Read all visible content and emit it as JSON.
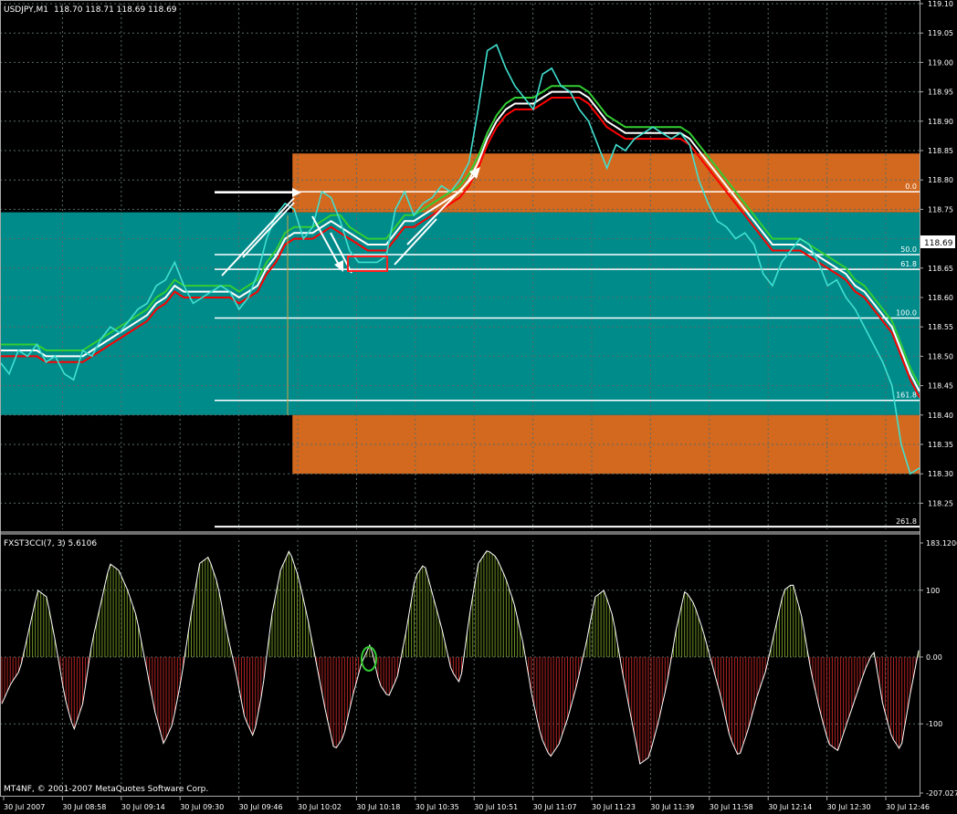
{
  "window": {
    "symbol_label": "USDJPY,M1",
    "ohlc_label": "118.70 118.71 118.69 118.69",
    "current_price": "118.69",
    "indicator_label": "FXST3CCI(7, 3) 5.6106",
    "copyright": "MT4NF, © 2001-2007 MetaQuotes Software Corp."
  },
  "colors": {
    "background": "#000000",
    "grid": "#5a6a6a",
    "cyan_zone": "#008b8b",
    "orange_zone": "#d2691e",
    "price_line": "#40e0d0",
    "ma_green": "#32cd32",
    "ma_white": "#ffffff",
    "ma_red": "#ff0000",
    "cci_positive": "#6b8e23",
    "cci_negative": "#b22222",
    "cci_line": "#ffffff",
    "marker_red": "#ff2020",
    "marker_green": "#32cd32"
  },
  "chart_data": [
    {
      "type": "line",
      "name": "price-panel",
      "y_ticks": [
        "119.10",
        "119.05",
        "119.00",
        "118.95",
        "118.90",
        "118.85",
        "118.80",
        "118.75",
        "118.70",
        "118.65",
        "118.60",
        "118.55",
        "118.50",
        "118.45",
        "118.40",
        "118.35",
        "118.30",
        "118.25"
      ],
      "ylim": [
        118.205,
        119.105
      ],
      "x": [
        0,
        0.01,
        0.02,
        0.03,
        0.04,
        0.05,
        0.06,
        0.07,
        0.08,
        0.09,
        0.1,
        0.11,
        0.12,
        0.13,
        0.14,
        0.15,
        0.16,
        0.17,
        0.18,
        0.19,
        0.2,
        0.21,
        0.22,
        0.23,
        0.24,
        0.25,
        0.26,
        0.27,
        0.28,
        0.29,
        0.3,
        0.31,
        0.32,
        0.33,
        0.34,
        0.35,
        0.36,
        0.37,
        0.38,
        0.39,
        0.4,
        0.41,
        0.42,
        0.43,
        0.44,
        0.45,
        0.46,
        0.47,
        0.48,
        0.49,
        0.5,
        0.51,
        0.52,
        0.53,
        0.54,
        0.55,
        0.56,
        0.57,
        0.58,
        0.59,
        0.6,
        0.61,
        0.62,
        0.63,
        0.64,
        0.65,
        0.66,
        0.67,
        0.68,
        0.69,
        0.7,
        0.71,
        0.72,
        0.73,
        0.74,
        0.75,
        0.76,
        0.77,
        0.78,
        0.79,
        0.8,
        0.81,
        0.82,
        0.83,
        0.84,
        0.85,
        0.86,
        0.87,
        0.88,
        0.89,
        0.9,
        0.91,
        0.92,
        0.93,
        0.94,
        0.95,
        0.96,
        0.97,
        0.98,
        0.99,
        1.0
      ],
      "series": [
        {
          "values": [
            118.49,
            118.47,
            118.51,
            118.5,
            118.52,
            118.49,
            118.5,
            118.47,
            118.46,
            118.51,
            118.5,
            118.53,
            118.55,
            118.54,
            118.56,
            118.58,
            118.59,
            118.62,
            118.63,
            118.66,
            118.62,
            118.59,
            118.6,
            118.61,
            118.62,
            118.61,
            118.58,
            118.6,
            118.64,
            118.7,
            118.74,
            118.76,
            118.75,
            118.7,
            118.72,
            118.78,
            118.77,
            118.73,
            118.68,
            118.66,
            118.66,
            118.66,
            118.67,
            118.75,
            118.78,
            118.74,
            118.76,
            118.77,
            118.79,
            118.78,
            118.8,
            118.83,
            118.92,
            119.02,
            119.03,
            118.99,
            118.96,
            118.94,
            118.92,
            118.98,
            118.99,
            118.96,
            118.95,
            118.92,
            118.9,
            118.86,
            118.82,
            118.86,
            118.85,
            118.87,
            118.88,
            118.89,
            118.88,
            118.87,
            118.88,
            118.86,
            118.8,
            118.76,
            118.73,
            118.72,
            118.7,
            118.71,
            118.69,
            118.64,
            118.62,
            118.66,
            118.68,
            118.7,
            118.69,
            118.66,
            118.62,
            118.63,
            118.6,
            118.58,
            118.55,
            118.52,
            118.49,
            118.45,
            118.35,
            118.3,
            118.31
          ]
        },
        {
          "values": [
            118.52,
            118.52,
            118.52,
            118.52,
            118.52,
            118.51,
            118.51,
            118.51,
            118.51,
            118.51,
            118.52,
            118.53,
            118.54,
            118.55,
            118.56,
            118.57,
            118.58,
            118.6,
            118.61,
            118.63,
            118.62,
            118.62,
            118.62,
            118.62,
            118.62,
            118.62,
            118.61,
            118.62,
            118.63,
            118.66,
            118.68,
            118.71,
            118.72,
            118.72,
            118.72,
            118.73,
            118.74,
            118.74,
            118.72,
            118.71,
            118.7,
            118.7,
            118.7,
            118.72,
            118.74,
            118.74,
            118.75,
            118.76,
            118.77,
            118.78,
            118.79,
            118.81,
            118.84,
            118.88,
            118.91,
            118.93,
            118.94,
            118.94,
            118.94,
            118.95,
            118.96,
            118.96,
            118.96,
            118.96,
            118.95,
            118.93,
            118.91,
            118.9,
            118.89,
            118.89,
            118.89,
            118.89,
            118.89,
            118.89,
            118.89,
            118.88,
            118.86,
            118.84,
            118.82,
            118.8,
            118.78,
            118.76,
            118.74,
            118.72,
            118.7,
            118.7,
            118.7,
            118.7,
            118.69,
            118.68,
            118.67,
            118.66,
            118.65,
            118.63,
            118.62,
            118.6,
            118.58,
            118.56,
            118.52,
            118.48,
            118.45
          ]
        },
        {
          "values": [
            118.51,
            118.51,
            118.51,
            118.51,
            118.51,
            118.5,
            118.5,
            118.5,
            118.5,
            118.5,
            118.51,
            118.52,
            118.53,
            118.54,
            118.55,
            118.56,
            118.57,
            118.59,
            118.6,
            118.62,
            118.61,
            118.61,
            118.61,
            118.61,
            118.61,
            118.61,
            118.6,
            118.61,
            118.62,
            118.65,
            118.67,
            118.7,
            118.71,
            118.71,
            118.71,
            118.72,
            118.73,
            118.72,
            118.71,
            118.7,
            118.69,
            118.69,
            118.69,
            118.71,
            118.73,
            118.73,
            118.74,
            118.75,
            118.76,
            118.77,
            118.78,
            118.8,
            118.83,
            118.87,
            118.9,
            118.92,
            118.93,
            118.93,
            118.93,
            118.94,
            118.95,
            118.95,
            118.95,
            118.95,
            118.94,
            118.92,
            118.9,
            118.89,
            118.88,
            118.88,
            118.88,
            118.88,
            118.88,
            118.88,
            118.88,
            118.87,
            118.85,
            118.83,
            118.81,
            118.79,
            118.77,
            118.75,
            118.73,
            118.71,
            118.69,
            118.69,
            118.69,
            118.69,
            118.68,
            118.67,
            118.66,
            118.65,
            118.64,
            118.62,
            118.61,
            118.59,
            118.57,
            118.55,
            118.51,
            118.47,
            118.44
          ]
        },
        {
          "values": [
            118.5,
            118.5,
            118.5,
            118.5,
            118.5,
            118.49,
            118.49,
            118.49,
            118.49,
            118.49,
            118.5,
            118.51,
            118.52,
            118.53,
            118.54,
            118.55,
            118.56,
            118.58,
            118.59,
            118.61,
            118.6,
            118.6,
            118.6,
            118.6,
            118.6,
            118.6,
            118.59,
            118.6,
            118.61,
            118.64,
            118.66,
            118.69,
            118.7,
            118.7,
            118.7,
            118.71,
            118.72,
            118.71,
            118.7,
            118.69,
            118.68,
            118.68,
            118.68,
            118.7,
            118.72,
            118.72,
            118.73,
            118.74,
            118.75,
            118.76,
            118.77,
            118.79,
            118.82,
            118.86,
            118.89,
            118.91,
            118.92,
            118.92,
            118.92,
            118.93,
            118.94,
            118.94,
            118.94,
            118.94,
            118.93,
            118.91,
            118.89,
            118.88,
            118.87,
            118.87,
            118.87,
            118.87,
            118.87,
            118.87,
            118.87,
            118.86,
            118.84,
            118.82,
            118.8,
            118.78,
            118.76,
            118.74,
            118.72,
            118.7,
            118.68,
            118.68,
            118.68,
            118.68,
            118.67,
            118.66,
            118.65,
            118.64,
            118.63,
            118.61,
            118.6,
            118.58,
            118.56,
            118.54,
            118.5,
            118.46,
            118.43
          ]
        }
      ],
      "zones": [
        {
          "color": "cyan_zone",
          "y_top": 118.745,
          "y_bottom": 118.4,
          "x_start": 0,
          "x_end": 1
        },
        {
          "color": "orange_zone",
          "y_top": 118.845,
          "y_bottom": 118.745,
          "x_start": 0.318,
          "x_end": 1
        },
        {
          "color": "orange_zone",
          "y_top": 118.4,
          "y_bottom": 118.3,
          "x_start": 0.318,
          "x_end": 1
        }
      ],
      "fib_levels": [
        {
          "label": "0.0",
          "value": 118.78
        },
        {
          "label": "50.0",
          "value": 118.673
        },
        {
          "label": "61.8",
          "value": 118.648
        },
        {
          "label": "100.0",
          "value": 118.565
        },
        {
          "label": "161.8",
          "value": 118.425
        },
        {
          "label": "261.8",
          "value": 118.21
        }
      ]
    },
    {
      "type": "bar",
      "name": "cci-panel",
      "y_ticks": [
        "183.1200",
        "100",
        "0.00",
        "-100",
        "-207.0273"
      ],
      "ylim": [
        -207.0273,
        183.12
      ],
      "x_labels": [
        "30 Jul 2007",
        "30 Jul 08:58",
        "30 Jul 09:14",
        "30 Jul 09:30",
        "30 Jul 09:46",
        "30 Jul 10:02",
        "30 Jul 10:18",
        "30 Jul 10:35",
        "30 Jul 10:51",
        "30 Jul 11:07",
        "30 Jul 11:23",
        "30 Jul 11:39",
        "30 Jul 11:58",
        "30 Jul 12:14",
        "30 Jul 12:30",
        "30 Jul 12:46"
      ],
      "values": [
        -70,
        -40,
        -20,
        40,
        100,
        90,
        20,
        -60,
        -110,
        -70,
        20,
        80,
        140,
        130,
        100,
        60,
        -10,
        -80,
        -130,
        -100,
        -30,
        60,
        140,
        150,
        110,
        40,
        -20,
        -90,
        -120,
        -50,
        60,
        130,
        160,
        120,
        60,
        -10,
        -80,
        -140,
        -120,
        -60,
        -10,
        20,
        -40,
        -60,
        -30,
        40,
        120,
        140,
        90,
        40,
        -20,
        -40,
        60,
        140,
        160,
        150,
        120,
        80,
        20,
        -60,
        -120,
        -150,
        -130,
        -90,
        -40,
        20,
        90,
        100,
        60,
        -20,
        -90,
        -160,
        -150,
        -100,
        -40,
        40,
        100,
        80,
        40,
        -10,
        -60,
        -120,
        -150,
        -110,
        -60,
        -20,
        40,
        100,
        110,
        60,
        -20,
        -80,
        -130,
        -140,
        -100,
        -60,
        -20,
        10,
        -70,
        -120,
        -140,
        -60,
        10
      ]
    }
  ]
}
